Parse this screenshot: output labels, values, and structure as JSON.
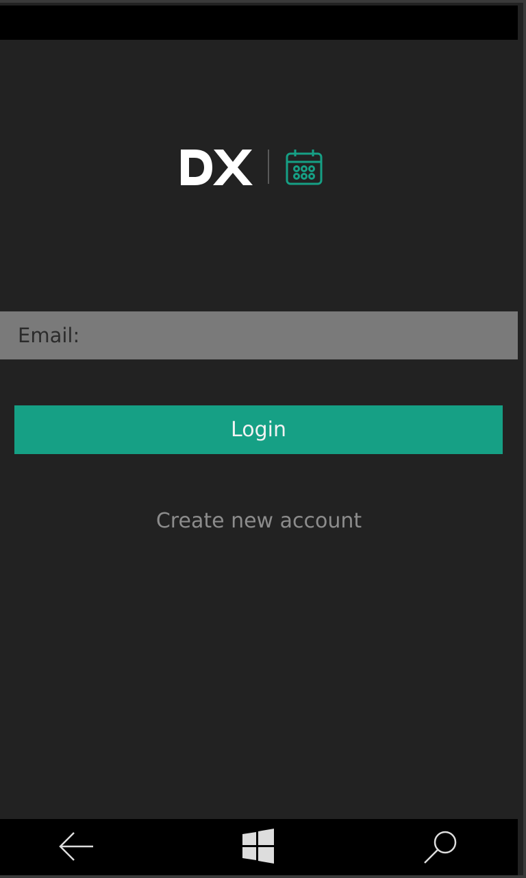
{
  "app": {
    "logo": {
      "wordmark": "DX",
      "icon": "calendar-icon",
      "wordmark_color": "#ffffff",
      "accent_color": "#16a085"
    }
  },
  "login_form": {
    "email_placeholder": "Email:",
    "email_value": "",
    "login_label": "Login",
    "create_account_label": "Create new account"
  },
  "nav_bar": {
    "back_icon": "back-arrow-icon",
    "home_icon": "windows-icon",
    "search_icon": "search-icon"
  },
  "colors": {
    "background": "#222222",
    "field_background": "#7a7a7a",
    "button": "#16a085",
    "link_text": "#8c8c8c",
    "system_bar": "#000000"
  }
}
